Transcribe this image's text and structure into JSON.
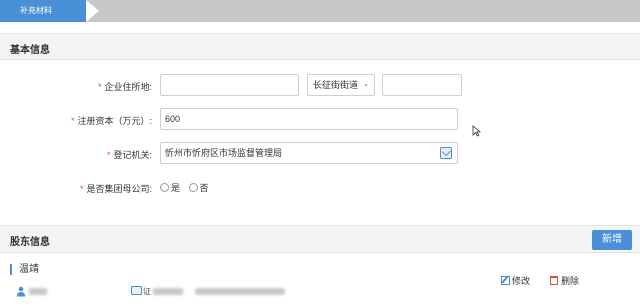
{
  "steps": [
    {
      "label": "补充材料",
      "active": true
    }
  ],
  "basic_info": {
    "title": "基本信息",
    "address": {
      "label": "企业住所地:",
      "value1": "",
      "street_select": "长征街街道",
      "value2": ""
    },
    "capital": {
      "label": "注册资本（万元）:",
      "value": "600"
    },
    "authority": {
      "label": "登记机关:",
      "value": "忻州市忻府区市场监督管理局"
    },
    "parent_company": {
      "label": "是否集团母公司:",
      "options": [
        "是",
        "否"
      ]
    }
  },
  "shareholders": {
    "title": "股东信息",
    "add_label": "新增",
    "items": [
      {
        "name": "温靖",
        "id_prefix": "证",
        "edit_label": "修改",
        "delete_label": "删除"
      }
    ]
  },
  "colors": {
    "accent": "#4a90d9",
    "required": "#e74c3c",
    "section_bg": "#f4f4f4"
  }
}
